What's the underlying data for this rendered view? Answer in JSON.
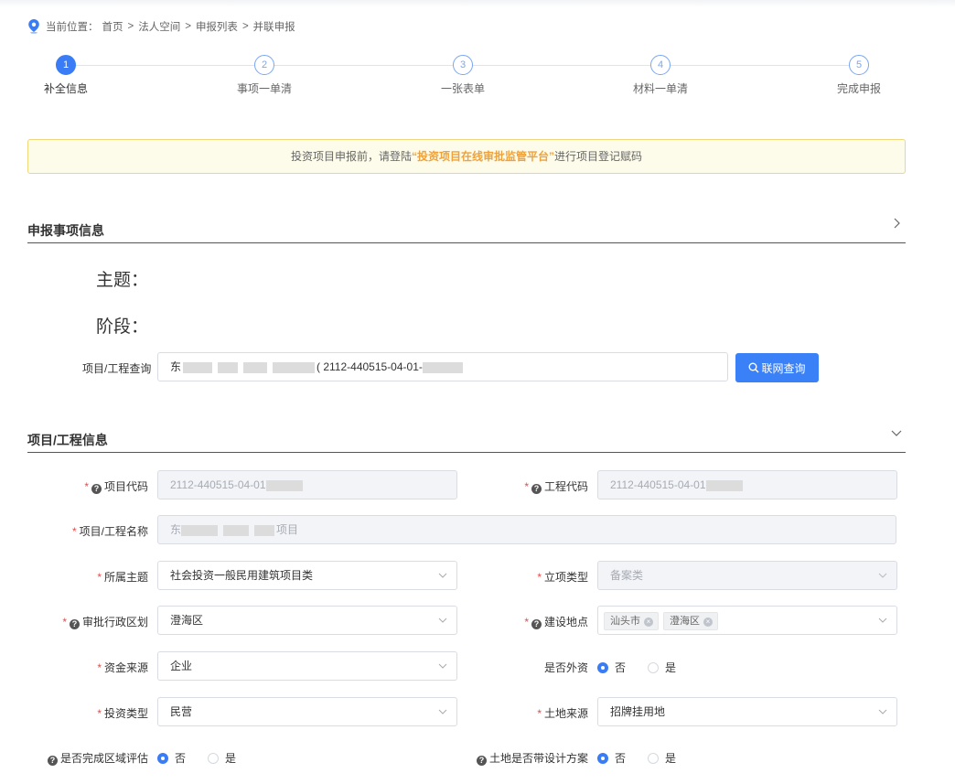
{
  "breadcrumb": {
    "prefix": "当前位置：",
    "items": [
      "首页",
      "法人空间",
      "申报列表",
      "并联申报"
    ],
    "separator": ">"
  },
  "steps": [
    {
      "num": "1",
      "label": "补全信息",
      "active": true
    },
    {
      "num": "2",
      "label": "事项一单清",
      "active": false
    },
    {
      "num": "3",
      "label": "一张表单",
      "active": false
    },
    {
      "num": "4",
      "label": "材料一单清",
      "active": false
    },
    {
      "num": "5",
      "label": "完成申报",
      "active": false
    }
  ],
  "notice": {
    "before": "投资项目申报前，请登陆",
    "highlight": "“投资项目在线审批监管平台”",
    "after": "进行项目登记赋码"
  },
  "section1": {
    "title": "申报事项信息",
    "subject_label": "主题：",
    "stage_label": "阶段：",
    "query_label": "项目/工程查询",
    "query_value_prefix": "东",
    "query_value_code": "( 2112-440515-04-01-",
    "query_button": "联网查询"
  },
  "section2": {
    "title": "项目/工程信息",
    "project_code_label": "项目代码",
    "project_code_value": "2112-440515-04-01",
    "eng_code_label": "工程代码",
    "eng_code_value": "2112-440515-04-01",
    "name_label": "项目/工程名称",
    "name_prefix": "东",
    "name_suffix": "项目",
    "theme_label": "所属主题",
    "theme_value": "社会投资一般民用建筑项目类",
    "lixiang_label": "立项类型",
    "lixiang_value": "备案类",
    "region_label": "审批行政区划",
    "region_value": "澄海区",
    "location_label": "建设地点",
    "location_tags": [
      "汕头市",
      "澄海区"
    ],
    "fund_label": "资金来源",
    "fund_value": "企业",
    "foreign_label": "是否外资",
    "invest_label": "投资类型",
    "invest_value": "民营",
    "land_label": "土地来源",
    "land_value": "招牌挂用地",
    "regional_eval_label": "是否完成区域评估",
    "land_design_label": "土地是否带设计方案",
    "radio_no": "否",
    "radio_yes": "是"
  },
  "colors": {
    "primary": "#3a80f6",
    "required": "#e84a4a",
    "notice_highlight": "#f0a23a"
  },
  "icons": {
    "breadcrumb": "location-pin-icon",
    "query": "search-icon",
    "select": "chevron-down-icon",
    "collapse": "chevron-right-icon"
  }
}
